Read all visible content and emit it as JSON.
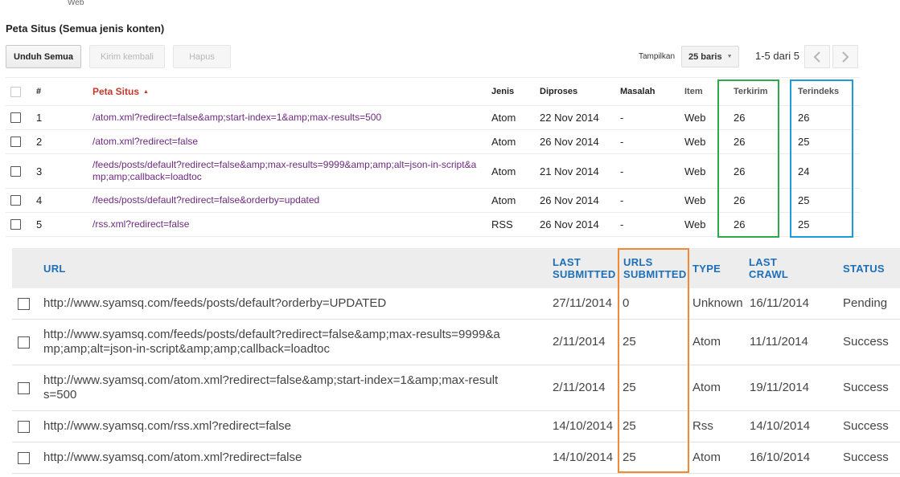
{
  "breadcrumb": "Web",
  "section_title": "Peta Situs (Semua jenis konten)",
  "toolbar": {
    "download_all": "Unduh Semua",
    "resend": "Kirim kembali",
    "delete": "Hapus",
    "show_label": "Tampilkan",
    "rows_per_page": "25 baris",
    "page_info": "1-5 dari 5"
  },
  "sitemaps_table": {
    "headers": {
      "num": "#",
      "sitemap": "Peta Situs",
      "type": "Jenis",
      "processed": "Diproses",
      "issues": "Masalah",
      "item": "Item",
      "submitted": "Terkirim",
      "indexed": "Terindeks"
    },
    "rows": [
      {
        "num": "1",
        "path": "/atom.xml?redirect=false&amp;start-index=1&amp;max-results=500",
        "type": "Atom",
        "processed": "22 Nov 2014",
        "issues": "-",
        "item": "Web",
        "submitted": "26",
        "indexed": "26"
      },
      {
        "num": "2",
        "path": "/atom.xml?redirect=false",
        "type": "Atom",
        "processed": "26 Nov 2014",
        "issues": "-",
        "item": "Web",
        "submitted": "26",
        "indexed": "25"
      },
      {
        "num": "3",
        "path": "/feeds/posts/default?redirect=false&amp;max-results=9999&amp;amp;alt=json-in-script&amp;amp;callback=loadtoc",
        "type": "Atom",
        "processed": "21 Nov 2014",
        "issues": "-",
        "item": "Web",
        "submitted": "26",
        "indexed": "24"
      },
      {
        "num": "4",
        "path": "/feeds/posts/default?redirect=false&orderby=updated",
        "type": "Atom",
        "processed": "26 Nov 2014",
        "issues": "-",
        "item": "Web",
        "submitted": "26",
        "indexed": "25"
      },
      {
        "num": "5",
        "path": "/rss.xml?redirect=false",
        "type": "RSS",
        "processed": "26 Nov 2014",
        "issues": "-",
        "item": "Web",
        "submitted": "26",
        "indexed": "25"
      }
    ]
  },
  "old_table": {
    "headers": {
      "url": "URL",
      "last_submitted": "LAST SUBMITTED",
      "urls_submitted": "URLS SUBMITTED",
      "type": "TYPE",
      "last_crawl": "LAST CRAWL",
      "status": "STATUS"
    },
    "rows": [
      {
        "url": "http://www.syamsq.com/feeds/posts/default?orderby=UPDATED",
        "last_submitted": "27/11/2014",
        "urls_submitted": "0",
        "type": "Unknown",
        "last_crawl": "16/11/2014",
        "status": "Pending"
      },
      {
        "url": "http://www.syamsq.com/feeds/posts/default?redirect=false&amp;max-results=9999&amp;amp;alt=json-in-script&amp;amp;callback=loadtoc",
        "last_submitted": "2/11/2014",
        "urls_submitted": "25",
        "type": "Atom",
        "last_crawl": "11/11/2014",
        "status": "Success"
      },
      {
        "url": "http://www.syamsq.com/atom.xml?redirect=false&amp;start-index=1&amp;max-results=500",
        "last_submitted": "2/11/2014",
        "urls_submitted": "25",
        "type": "Atom",
        "last_crawl": "19/11/2014",
        "status": "Success"
      },
      {
        "url": "http://www.syamsq.com/rss.xml?redirect=false",
        "last_submitted": "14/10/2014",
        "urls_submitted": "25",
        "type": "Rss",
        "last_crawl": "14/10/2014",
        "status": "Success"
      },
      {
        "url": "http://www.syamsq.com/atom.xml?redirect=false",
        "last_submitted": "14/10/2014",
        "urls_submitted": "25",
        "type": "Atom",
        "last_crawl": "16/10/2014",
        "status": "Success"
      }
    ]
  },
  "highlight_colors": {
    "submitted": "#2da84a",
    "indexed": "#1e9cd7",
    "urls_submitted": "#f08a33"
  },
  "icons": {
    "prev": "chevron-left-icon",
    "next": "chevron-right-icon",
    "sort": "sort-ascending-icon",
    "dropdown": "caret-down-icon"
  }
}
